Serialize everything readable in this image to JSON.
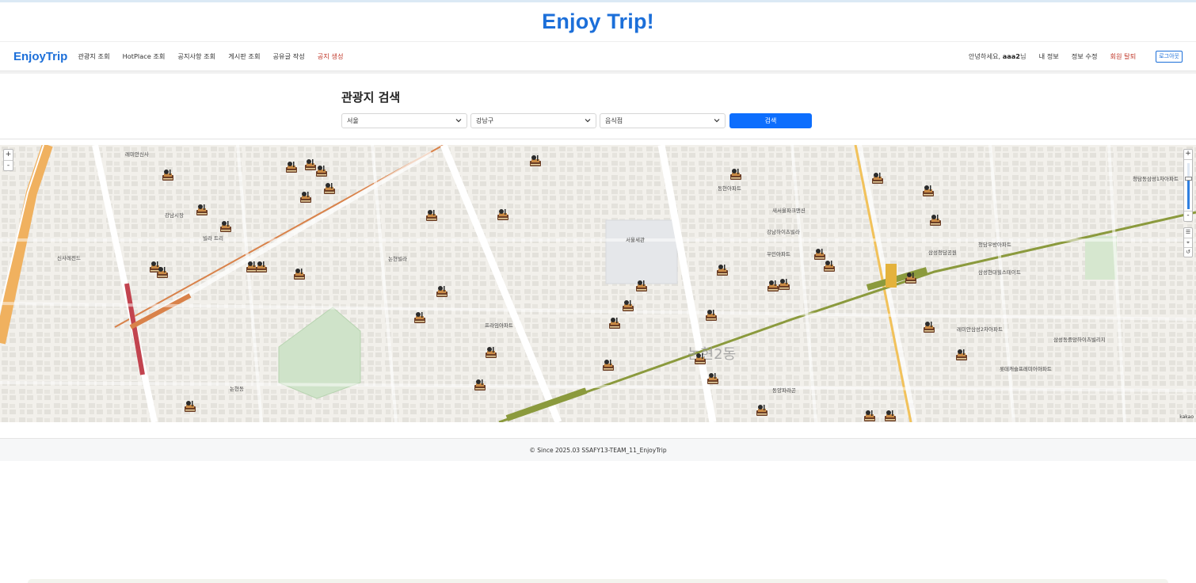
{
  "banner": {
    "title": "Enjoy Trip!"
  },
  "nav": {
    "brand": "EnjoyTrip",
    "links": [
      "관광지 조회",
      "HotPlace 조회",
      "공지사항 조회",
      "게시판 조회",
      "공유글 작성",
      "공지 생성"
    ],
    "greeting_prefix": "안녕하세요, ",
    "username": "aaa2",
    "greeting_suffix": "님",
    "my_info": "내 정보",
    "edit_info": "정보 수정",
    "withdraw": "회원 탈퇴",
    "logout": "로그아웃"
  },
  "search": {
    "title": "관광지 검색",
    "region": "서울",
    "district": "강남구",
    "category": "음식점",
    "button": "검색"
  },
  "map": {
    "zoom_in": "+",
    "zoom_out": "-",
    "logo": "kakao",
    "labels": {
      "dong_big": "논현2동",
      "l1": "레미안신사",
      "l2": "신사레전드",
      "l3": "강남시장",
      "l4": "빌라 트리",
      "l5": "논현빌라",
      "l6": "서울세관",
      "l7": "강남하이츠빌라",
      "l8": "우민아파트",
      "l9": "새서울파크맨션",
      "l10": "동현아파트",
      "l11": "삼성청담공원",
      "l12": "청담우방아파트",
      "l13": "삼성현대힐스테이트",
      "l14": "청담동삼성1차아파트",
      "l15": "레미안삼성2차아파트",
      "l16": "롯데캐슬프레미어아파트",
      "l17": "삼성동중앙하이츠빌리지",
      "l18": "프라임아파트",
      "l19": "동양파라곤",
      "l20": "논현동"
    },
    "marker_icon": "restaurant-marker-icon"
  },
  "footer": {
    "text": "© Since 2025.03 SSAFY13-TEAM_11_EnjoyTrip"
  }
}
